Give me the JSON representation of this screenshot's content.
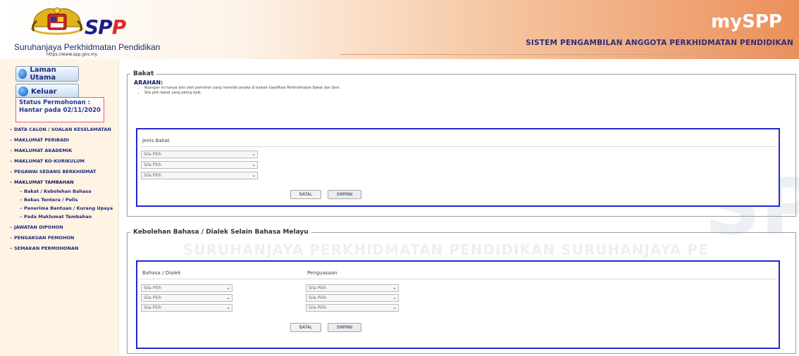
{
  "header": {
    "logo_text": "SPP",
    "org_name": "Suruhanjaya Perkhidmatan Pendidikan",
    "org_url": "https://www.spp.gov.my",
    "brand": "mySPP",
    "system_title": "SISTEM PENGAMBILAN ANGGOTA PERKHIDMATAN PENDIDIKAN"
  },
  "sidebar": {
    "home_button": "Laman Utama",
    "logout_button": "Keluar",
    "status_text": "Status Permohonan : Hantar pada 02/11/2020",
    "menu": [
      "DATA CALON / SOALAN KESELAMATAN",
      "MAKLUMAT PERIBADI",
      "MAKLUMAT AKADEMIK",
      "MAKLUMAT KO-KURIKULUM",
      "PEGAWAI SEDANG BERKHIDMAT",
      "MAKLUMAT TAMBAHAN"
    ],
    "submenu": [
      "Bakat / Kebolehan Bahasa",
      "Bekas Tentera / Polis",
      "Penerima Bantuan / Kurang Upaya",
      "Pada Maklumat Tambahan"
    ],
    "menu_after": [
      "JAWATAN DIPOHON",
      "PENGAKUAN PEMOHON",
      "SEMAKAN PERMOHONAN"
    ]
  },
  "bakat": {
    "legend": "Bakat",
    "arahan_label": "ARAHAN:",
    "instructions": [
      "Ruangan ini hanya diisi oleh pemohon yang memiliki jenaka di bawah klasifikasi Perkhidmatan Bakat dan Seni.",
      "Sila pilih bakat yang paling baik."
    ],
    "column_label": "Jenis Bakat",
    "selects": [
      "Sila Pilih",
      "Sila Pilih",
      "Sila Pilih"
    ],
    "batal_label": "BATAL",
    "simpan_label": "SIMPAN"
  },
  "bahasa": {
    "legend": "Kebolehan Bahasa / Dialek Selain Bahasa Melayu",
    "col1_label": "Bahasa / Dialek",
    "col2_label": "Penguasaan",
    "selects_col1": [
      "Sila Pilih",
      "Sila Pilih",
      "Sila Pilih"
    ],
    "selects_col2": [
      "Sila Pilih",
      "Sila Pilih",
      "Sila Pilih"
    ],
    "batal_label": "BATAL",
    "simpan_label": "SIMPAN"
  },
  "watermark": {
    "band_text": "SURUHANJAYA PERKHIDMATAN PENDIDIKAN   SURUHANJAYA PE",
    "big_text": "SP"
  }
}
